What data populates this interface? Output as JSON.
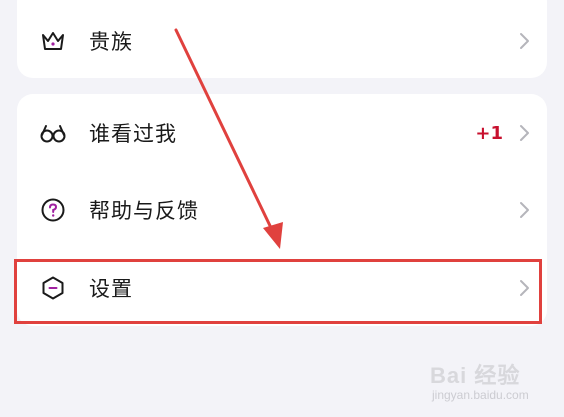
{
  "menu_top": {
    "items": [
      {
        "label": "贵族",
        "icon": "crown-icon"
      }
    ]
  },
  "menu_main": {
    "items": [
      {
        "label": "谁看过我",
        "icon": "glasses-icon",
        "badge": "+1"
      },
      {
        "label": "帮助与反馈",
        "icon": "help-question-icon"
      },
      {
        "label": "设置",
        "icon": "settings-hexagon-icon"
      }
    ]
  },
  "colors": {
    "background": "#f3f3f8",
    "card": "#ffffff",
    "accent_purple": "#a020a0",
    "badge_red": "#c8102e",
    "annotation_red": "#e0413e",
    "chevron_gray": "#b5b5bb"
  },
  "watermark": {
    "brand": "Bai 经验",
    "url": "jingyan.baidu.com"
  }
}
